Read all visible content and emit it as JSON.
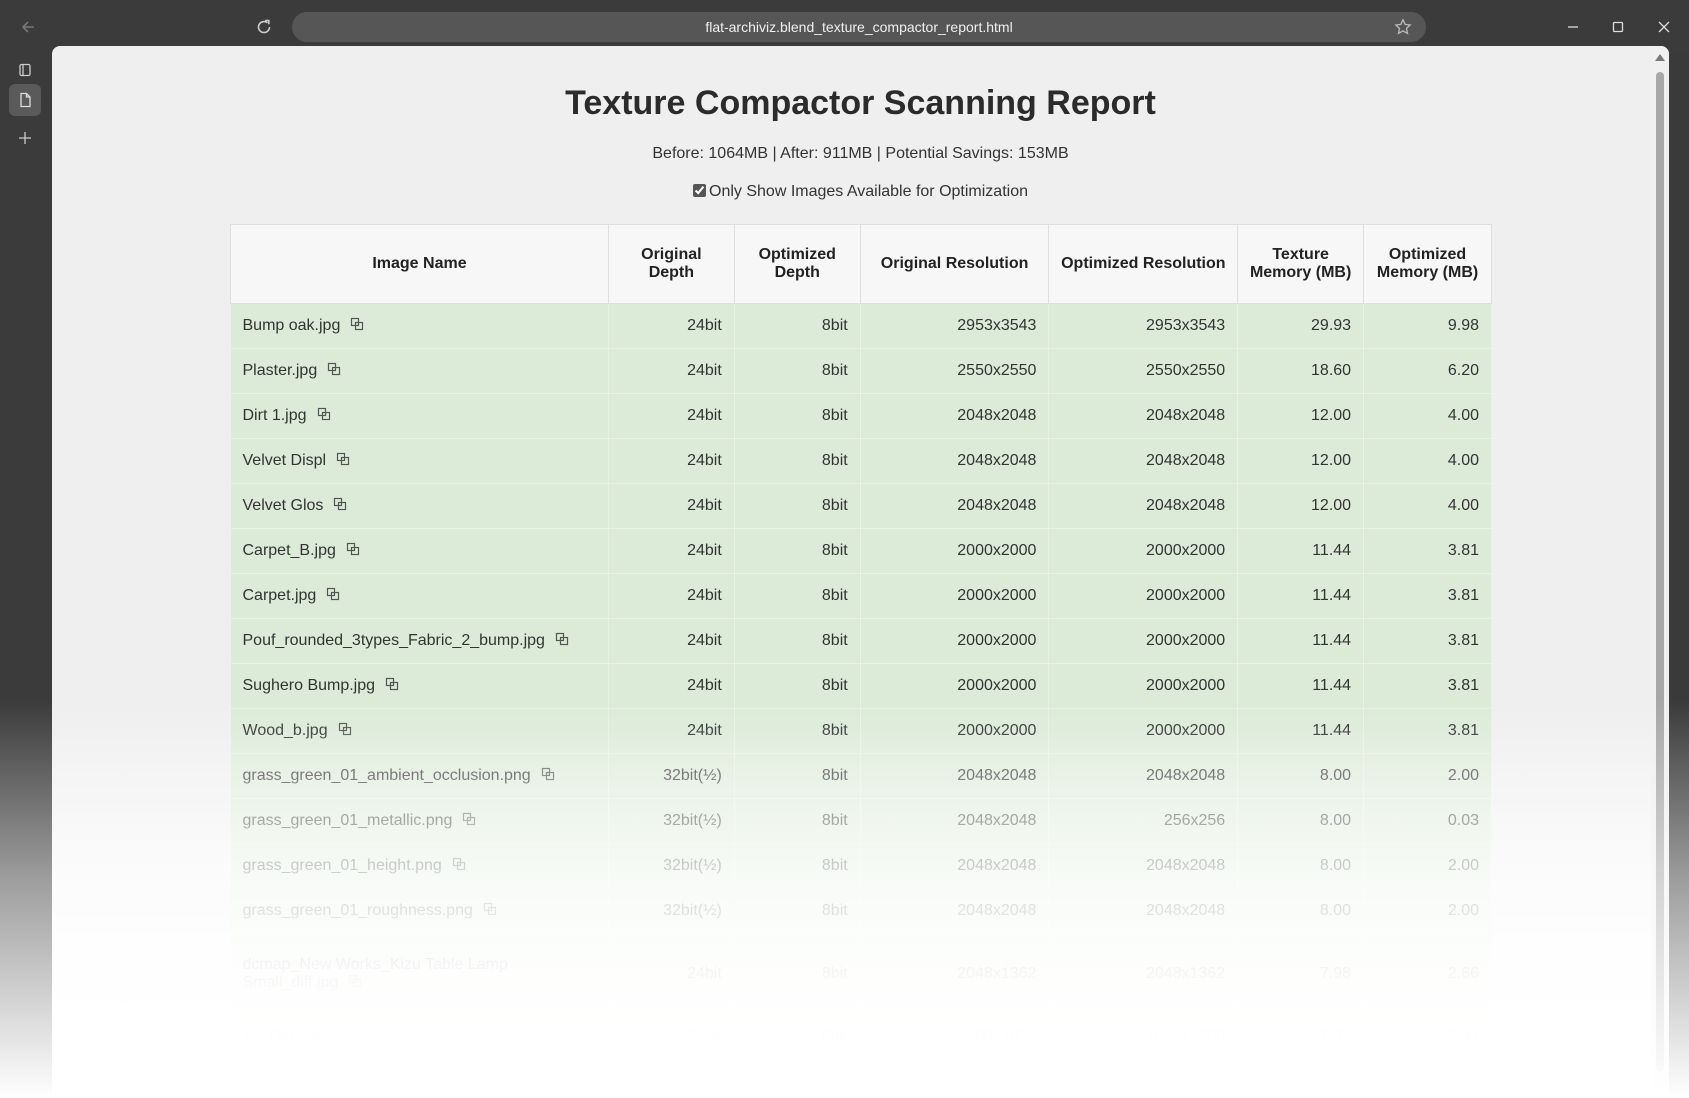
{
  "browser": {
    "url": "flat-archiviz.blend_texture_compactor_report.html"
  },
  "report": {
    "title": "Texture Compactor Scanning Report",
    "summary": "Before: 1064MB | After: 911MB | Potential Savings: 153MB",
    "filter_label": "Only Show Images Available for Optimization",
    "filter_checked": true
  },
  "table": {
    "headers": [
      "Image Name",
      "Original Depth",
      "Optimized Depth",
      "Original Resolution",
      "Optimized Resolution",
      "Texture Memory (MB)",
      "Optimized Memory (MB)"
    ],
    "rows": [
      {
        "name": "Bump oak.jpg",
        "orig_depth": "24bit",
        "opt_depth": "8bit",
        "orig_res": "2953x3543",
        "opt_res": "2953x3543",
        "tex_mem": "29.93",
        "opt_mem": "9.98"
      },
      {
        "name": "Plaster.jpg",
        "orig_depth": "24bit",
        "opt_depth": "8bit",
        "orig_res": "2550x2550",
        "opt_res": "2550x2550",
        "tex_mem": "18.60",
        "opt_mem": "6.20"
      },
      {
        "name": "Dirt 1.jpg",
        "orig_depth": "24bit",
        "opt_depth": "8bit",
        "orig_res": "2048x2048",
        "opt_res": "2048x2048",
        "tex_mem": "12.00",
        "opt_mem": "4.00"
      },
      {
        "name": "Velvet Displ",
        "orig_depth": "24bit",
        "opt_depth": "8bit",
        "orig_res": "2048x2048",
        "opt_res": "2048x2048",
        "tex_mem": "12.00",
        "opt_mem": "4.00"
      },
      {
        "name": "Velvet Glos",
        "orig_depth": "24bit",
        "opt_depth": "8bit",
        "orig_res": "2048x2048",
        "opt_res": "2048x2048",
        "tex_mem": "12.00",
        "opt_mem": "4.00"
      },
      {
        "name": "Carpet_B.jpg",
        "orig_depth": "24bit",
        "opt_depth": "8bit",
        "orig_res": "2000x2000",
        "opt_res": "2000x2000",
        "tex_mem": "11.44",
        "opt_mem": "3.81"
      },
      {
        "name": "Carpet.jpg",
        "orig_depth": "24bit",
        "opt_depth": "8bit",
        "orig_res": "2000x2000",
        "opt_res": "2000x2000",
        "tex_mem": "11.44",
        "opt_mem": "3.81"
      },
      {
        "name": "Pouf_rounded_3types_Fabric_2_bump.jpg",
        "orig_depth": "24bit",
        "opt_depth": "8bit",
        "orig_res": "2000x2000",
        "opt_res": "2000x2000",
        "tex_mem": "11.44",
        "opt_mem": "3.81"
      },
      {
        "name": "Sughero Bump.jpg",
        "orig_depth": "24bit",
        "opt_depth": "8bit",
        "orig_res": "2000x2000",
        "opt_res": "2000x2000",
        "tex_mem": "11.44",
        "opt_mem": "3.81"
      },
      {
        "name": "Wood_b.jpg",
        "orig_depth": "24bit",
        "opt_depth": "8bit",
        "orig_res": "2000x2000",
        "opt_res": "2000x2000",
        "tex_mem": "11.44",
        "opt_mem": "3.81"
      },
      {
        "name": "grass_green_01_ambient_occlusion.png",
        "orig_depth": "32bit(½)",
        "opt_depth": "8bit",
        "orig_res": "2048x2048",
        "opt_res": "2048x2048",
        "tex_mem": "8.00",
        "opt_mem": "2.00"
      },
      {
        "name": "grass_green_01_metallic.png",
        "orig_depth": "32bit(½)",
        "opt_depth": "8bit",
        "orig_res": "2048x2048",
        "opt_res": "256x256",
        "tex_mem": "8.00",
        "opt_mem": "0.03"
      },
      {
        "name": "grass_green_01_height.png",
        "orig_depth": "32bit(½)",
        "opt_depth": "8bit",
        "orig_res": "2048x2048",
        "opt_res": "2048x2048",
        "tex_mem": "8.00",
        "opt_mem": "2.00"
      },
      {
        "name": "grass_green_01_roughness.png",
        "orig_depth": "32bit(½)",
        "opt_depth": "8bit",
        "orig_res": "2048x2048",
        "opt_res": "2048x2048",
        "tex_mem": "8.00",
        "opt_mem": "2.00"
      },
      {
        "name": "dcmap_New Works_Kizu Table Lamp Small_diff.jpg",
        "orig_depth": "24bit",
        "opt_depth": "8bit",
        "orig_res": "2048x1362",
        "opt_res": "2048x1362",
        "tex_mem": "7.98",
        "opt_mem": "2.66"
      },
      {
        "name": "Vol Dirt.jpg",
        "orig_depth": "24bit",
        "opt_depth": "8bit",
        "orig_res": "1800x1800",
        "opt_res": "1800x1800",
        "tex_mem": "7.32",
        "opt_mem": "2.44"
      }
    ]
  },
  "icons": {
    "back": "back-arrow-icon",
    "reload": "reload-icon",
    "star": "star-icon",
    "minimize": "minimize-icon",
    "maximize": "maximize-icon",
    "close": "close-icon",
    "tabs": "tabs-icon",
    "page": "page-icon",
    "new_tab": "plus-icon",
    "copy": "copy-icon"
  }
}
